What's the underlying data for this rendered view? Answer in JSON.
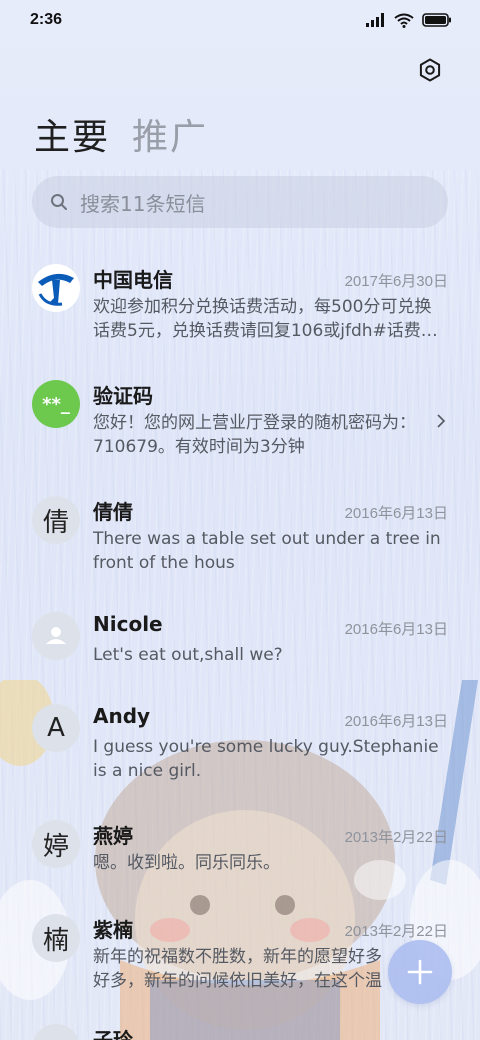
{
  "status_bar": {
    "time": "2:36"
  },
  "tabs": [
    {
      "label": "主要"
    },
    {
      "label": "推广"
    }
  ],
  "search": {
    "placeholder": "搜索11条短信"
  },
  "conversations": [
    {
      "name": "中国电信",
      "date": "2017年6月30日",
      "snippet": "欢迎参加积分兑换话费活动，每500分可兑换话费5元，兑换话费请回复106或jfdh#话费…",
      "avatar": "telecom-logo-icon"
    },
    {
      "name": "验证码",
      "date": "",
      "snippet": "您好！您的网上营业厅登录的随机密码为：710679。有效时间为3分钟",
      "avatar_text": "**_"
    },
    {
      "name": "倩倩",
      "date": "2016年6月13日",
      "snippet": "There was a table set out under a tree in front of the hous",
      "avatar_text": "倩"
    },
    {
      "name": "Nicole",
      "date": "2016年6月13日",
      "snippet": "Let's eat out,shall we?",
      "avatar": "person-icon"
    },
    {
      "name": "Andy",
      "date": "2016年6月13日",
      "snippet": "I guess you're some lucky guy.Stephanie is a nice girl.",
      "avatar_text": "A"
    },
    {
      "name": "燕婷",
      "date": "2013年2月22日",
      "snippet": "嗯。收到啦。同乐同乐。",
      "avatar_text": "婷"
    },
    {
      "name": "紫楠",
      "date": "2013年2月22日",
      "snippet": "新年的祝福数不胜数，新年的愿望好多好多，新年的问候依旧美好，在这个温馨的时刻",
      "avatar_text": "楠"
    },
    {
      "name": "子玲",
      "date": "",
      "snippet": "",
      "avatar_text": ""
    }
  ],
  "colors": {
    "accent_fab": "#a8baee",
    "verify_avatar": "#6cc94e",
    "telecom_blue": "#0a5cb8"
  }
}
